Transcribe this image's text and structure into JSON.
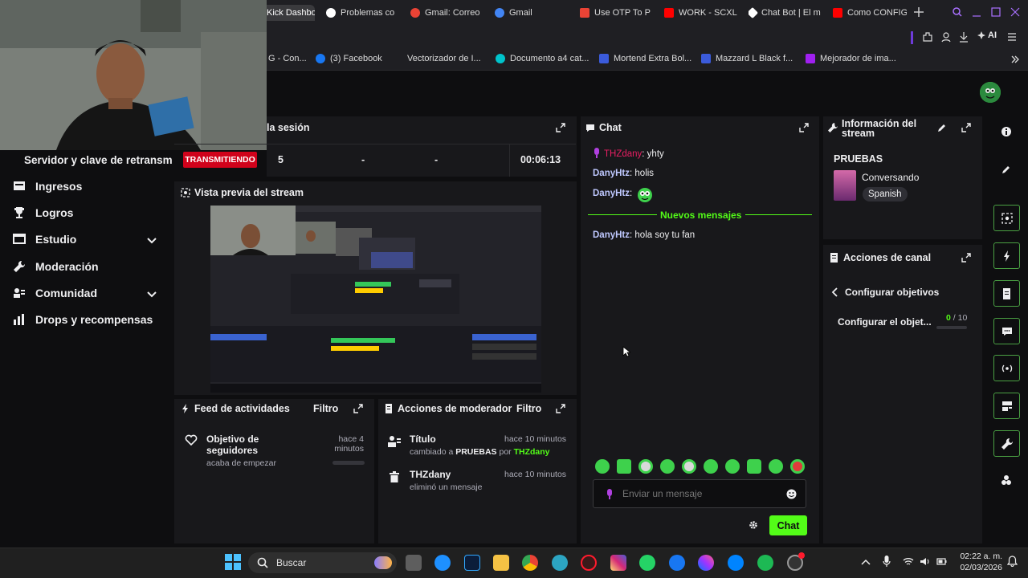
{
  "browser": {
    "tabs": [
      {
        "label": "Kick Dashbo",
        "active": true,
        "color": "#53fc18"
      },
      {
        "label": "Problemas co",
        "color": "#ffffff"
      },
      {
        "label": "Gmail: Correo",
        "color": "#ea4335"
      },
      {
        "label": "Gmail",
        "color": "#ea4335"
      },
      {
        "label": "Use OTP To P",
        "color": "#ea4335"
      },
      {
        "label": "WORK - SCXL",
        "color": "#ff0000"
      },
      {
        "label": "Chat Bot | El m",
        "color": "#ffffff"
      },
      {
        "label": "Como CONFIG",
        "color": "#ff0000"
      }
    ],
    "ai_label": "AI",
    "bookmarks": [
      {
        "label": "G - Con...",
        "color": "#888888"
      },
      {
        "label": "(3) Facebook",
        "color": "#1877f2"
      },
      {
        "label": "Vectorizador de I...",
        "color": "#333333"
      },
      {
        "label": "Documento a4 cat...",
        "color": "#00c4cc"
      },
      {
        "label": "Mortend Extra Bol...",
        "color": "#3b5bdb"
      },
      {
        "label": "Mazzard L Black f...",
        "color": "#3b5bdb"
      },
      {
        "label": "Mejorador de ima...",
        "color": "#a020f0"
      }
    ]
  },
  "session": {
    "title": "la sesión",
    "stream_key_label": "Servidor y clave de retransm",
    "live_badge": "TRANSMITIENDO",
    "stats": [
      "5",
      "-",
      "-",
      "00:06:13"
    ]
  },
  "sidebar": {
    "items": [
      {
        "label": "Ingresos",
        "icon": "revenue-icon",
        "has_chevron": false
      },
      {
        "label": "Logros",
        "icon": "trophy-icon",
        "has_chevron": false
      },
      {
        "label": "Estudio",
        "icon": "studio-icon",
        "has_chevron": true
      },
      {
        "label": "Moderación",
        "icon": "wrench-icon",
        "has_chevron": false
      },
      {
        "label": "Comunidad",
        "icon": "community-icon",
        "has_chevron": true
      },
      {
        "label": "Drops y recompensas",
        "icon": "drops-icon",
        "has_chevron": false
      }
    ]
  },
  "preview": {
    "title": "Vista previa del stream"
  },
  "feed": {
    "title": "Feed de actividades",
    "filter": "Filtro",
    "item": {
      "title": "Objetivo de seguidores",
      "subtitle": "acaba de empezar",
      "time": "hace 4 minutos"
    }
  },
  "modactions": {
    "title": "Acciones de moderador",
    "filter": "Filtro",
    "items": [
      {
        "title": "Título",
        "time": "hace 10 minutos",
        "pre": "cambiado a",
        "value": "PRUEBAS",
        "by": "por",
        "user": "THZdany"
      },
      {
        "title": "THZdany",
        "time": "hace 10 minutos",
        "desc": "eliminó un mensaje"
      }
    ]
  },
  "chat": {
    "title": "Chat",
    "messages": [
      {
        "user": "THZdany",
        "text": ": yhty",
        "color": "#e91e63"
      },
      {
        "user": "DanyHtz",
        "text": ": holis",
        "color": "#bfc8ff"
      },
      {
        "user": "DanyHtz",
        "text": ":",
        "color": "#bfc8ff"
      },
      {
        "user": "DanyHtz",
        "text": ": hola soy tu fan",
        "color": "#bfc8ff"
      }
    ],
    "new_messages": "Nuevos mensajes",
    "input_placeholder": "Enviar un mensaje",
    "send_button": "Chat",
    "accent": "#53fc18"
  },
  "streaminfo": {
    "title": "Información del stream",
    "stream_title": "PRUEBAS",
    "category": "Conversando",
    "language": "Spanish"
  },
  "channel": {
    "title": "Acciones de canal",
    "back_label": "Configurar objetivos",
    "goal_label": "Configurar el objet...",
    "goal_current": "0",
    "goal_total": "/ 10",
    "goal_progress": 0
  },
  "taskbar": {
    "search": "Buscar",
    "time": "02:22 a. m.",
    "date": "02/03/2026"
  }
}
